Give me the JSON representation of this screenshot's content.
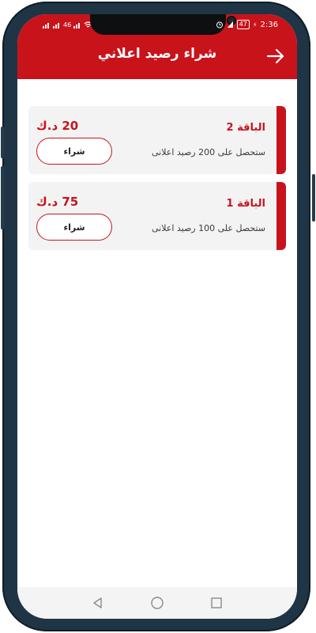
{
  "status_bar": {
    "left_text": "46",
    "battery": "47",
    "time": "2:36"
  },
  "header": {
    "title": "شراء رصيد اعلاني",
    "back_icon": "arrow-right-icon"
  },
  "packages": [
    {
      "name": "الباقة 2",
      "description": "ستحصل على 200 رصيد اعلانى",
      "price": "20 د.ك",
      "buy_label": "شراء"
    },
    {
      "name": "الباقة 1",
      "description": "ستحصل على 100 رصيد اعلانى",
      "price": "75 د.ك",
      "buy_label": "شراء"
    }
  ],
  "nav_bar": {
    "icons": [
      "back-triangle-icon",
      "home-circle-icon",
      "recents-square-icon"
    ]
  },
  "colors": {
    "primary": "#c8131b",
    "frame": "#1f3545",
    "card_bg": "#f3f3f4"
  }
}
